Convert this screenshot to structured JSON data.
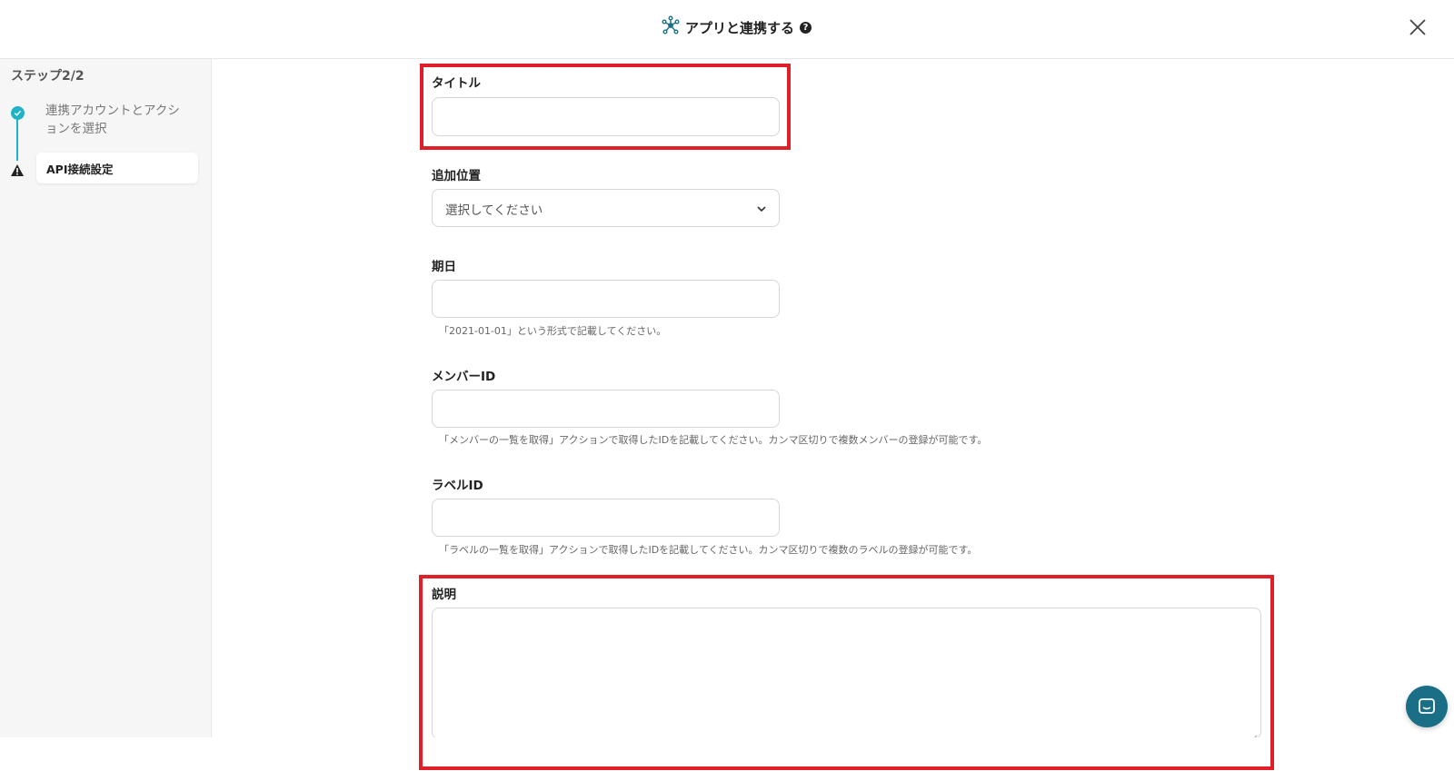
{
  "header": {
    "title": "アプリと連携する",
    "help_icon": "question-circle-icon",
    "close_icon": "close-icon",
    "app_icon": "integration-network-icon"
  },
  "sidebar": {
    "step_label": "ステップ2/2",
    "steps": [
      {
        "label": "連携アカウントとアクションを選択",
        "status": "complete"
      },
      {
        "label": "API接続設定",
        "status": "warning"
      }
    ]
  },
  "form": {
    "title": {
      "label": "タイトル",
      "value": ""
    },
    "position": {
      "label": "追加位置",
      "placeholder": "選択してください"
    },
    "due": {
      "label": "期日",
      "value": "",
      "help": "「2021-01-01」という形式で記載してください。"
    },
    "member": {
      "label": "メンバーID",
      "value": "",
      "help": "「メンバーの一覧を取得」アクションで取得したIDを記載してください。カンマ区切りで複数メンバーの登録が可能です。"
    },
    "labelid": {
      "label": "ラベルID",
      "value": "",
      "help": "「ラベルの一覧を取得」アクションで取得したIDを記載してください。カンマ区切りで複数のラベルの登録が可能です。"
    },
    "description": {
      "label": "説明",
      "value": ""
    }
  },
  "colors": {
    "accent": "#1fb3c8",
    "highlight": "#e01f26",
    "chat": "#1a6f87"
  }
}
